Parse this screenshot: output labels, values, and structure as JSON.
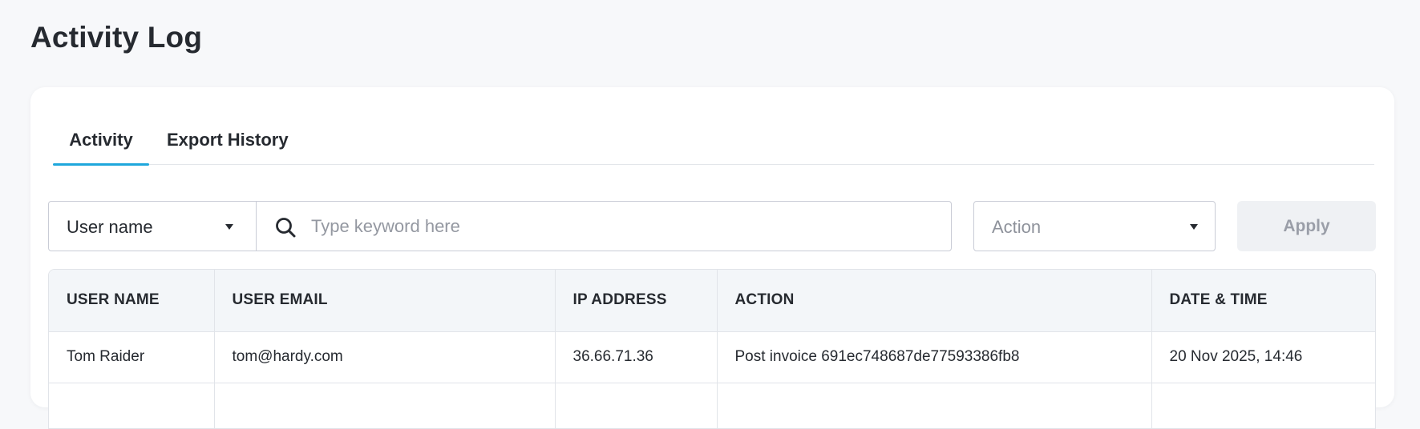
{
  "page": {
    "title": "Activity Log"
  },
  "tabs": [
    {
      "label": "Activity",
      "active": true
    },
    {
      "label": "Export History",
      "active": false
    }
  ],
  "filters": {
    "user_select": {
      "value": "User name"
    },
    "search": {
      "placeholder": "Type keyword here",
      "value": ""
    },
    "action_select": {
      "value": "Action"
    },
    "apply_label": "Apply"
  },
  "table": {
    "columns": [
      "USER NAME",
      "USER EMAIL",
      "IP ADDRESS",
      "ACTION",
      "DATE & TIME"
    ],
    "rows": [
      {
        "user_name": "Tom Raider",
        "user_email": "tom@hardy.com",
        "ip_address": "36.66.71.36",
        "action": "Post invoice 691ec748687de77593386fb8",
        "date_time": "20 Nov 2025, 14:46"
      }
    ]
  },
  "colors": {
    "accent": "#1ea7dc",
    "background": "#f7f8fa",
    "header_bg": "#f3f6f9"
  }
}
